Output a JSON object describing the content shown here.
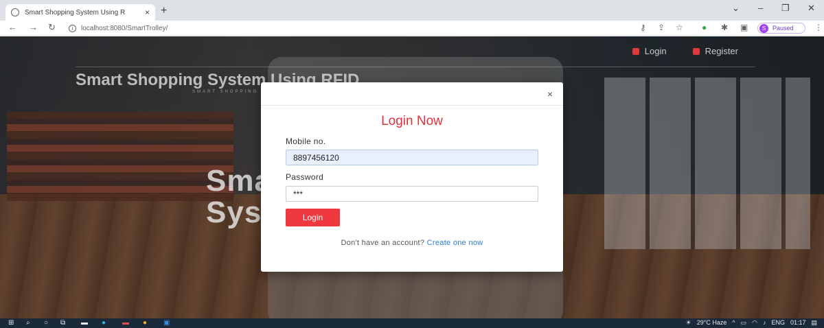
{
  "browser": {
    "tab_title": "Smart Shopping System Using R",
    "tab_close": "×",
    "new_tab": "+",
    "url": "localhost:8080/SmartTrolley/",
    "profile_label": "Paused",
    "profile_initial": "S",
    "window": {
      "dropdown": "⌄",
      "minimize": "–",
      "restore": "❐",
      "close": "✕"
    }
  },
  "site": {
    "nav": {
      "login": "Login",
      "register": "Register"
    },
    "brand": "Smart Shopping System Using RFID",
    "brand_sub": "SMART SHOPPING",
    "hero_line1": "Smart Shopping",
    "hero_line2": "System Using RFID"
  },
  "modal": {
    "close": "×",
    "title": "Login Now",
    "mobile_label": "Mobile no.",
    "mobile_value": "8897456120",
    "password_label": "Password",
    "password_value": "***",
    "login_button": "Login",
    "signup_prompt": "Don't have an account?",
    "signup_link": "Create one now"
  },
  "taskbar": {
    "weather": "29°C Haze",
    "language": "ENG",
    "time": "01:17"
  },
  "colors": {
    "accent": "#f0383f",
    "title": "#e0313b",
    "link": "#2a7bd6"
  }
}
